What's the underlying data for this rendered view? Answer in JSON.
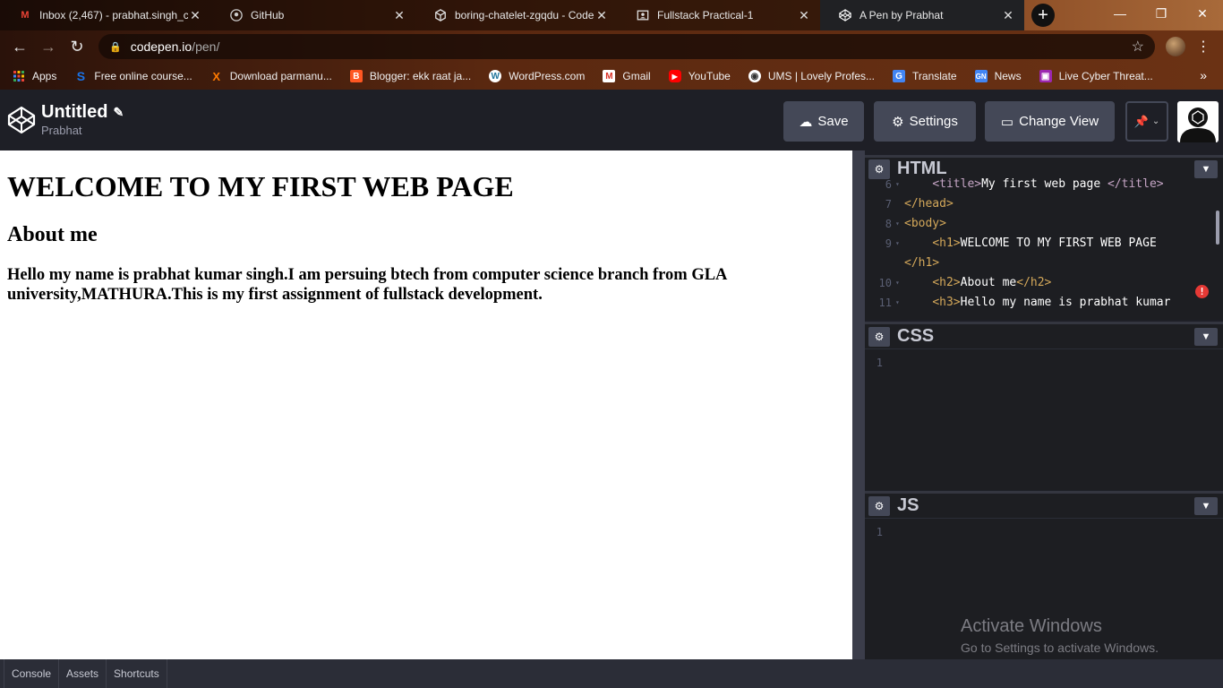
{
  "browser": {
    "tabs": [
      {
        "title": "Inbox (2,467) - prabhat.singh_c",
        "icon": "gmail-icon",
        "close": "✕"
      },
      {
        "title": "GitHub",
        "icon": "github-icon",
        "close": "✕"
      },
      {
        "title": "boring-chatelet-zgqdu - CodeS",
        "icon": "codesandbox-icon",
        "close": "✕"
      },
      {
        "title": "Fullstack Practical-1",
        "icon": "classroom-icon",
        "close": "✕"
      },
      {
        "title": "A Pen by Prabhat",
        "icon": "codepen-icon",
        "close": "✕"
      }
    ],
    "url_host": "codepen.io",
    "url_path": "/pen/",
    "bookmarks": [
      {
        "label": "Apps",
        "icon": "apps-grid-icon",
        "color": "#e94235"
      },
      {
        "label": "Free online course...",
        "icon": "course-icon",
        "color": "#1a73e8"
      },
      {
        "label": "Download parmanu...",
        "icon": "x-icon",
        "color": "#ff7a00"
      },
      {
        "label": "Blogger: ekk raat ja...",
        "icon": "blogger-icon",
        "color": "#ff5722"
      },
      {
        "label": "WordPress.com",
        "icon": "wordpress-icon",
        "color": "#21759b"
      },
      {
        "label": "Gmail",
        "icon": "gmail-icon",
        "color": "#d93025"
      },
      {
        "label": "YouTube",
        "icon": "youtube-icon",
        "color": "#ff0000"
      },
      {
        "label": "UMS | Lovely Profes...",
        "icon": "globe-icon",
        "color": "#ffffff"
      },
      {
        "label": "Translate",
        "icon": "translate-icon",
        "color": "#4285f4"
      },
      {
        "label": "News",
        "icon": "news-icon",
        "color": "#4285f4"
      },
      {
        "label": "Live Cyber Threat...",
        "icon": "threat-map-icon",
        "color": "#9c27b0"
      }
    ],
    "bookmarks_more": "»"
  },
  "codepen": {
    "title": "Untitled",
    "owner": "Prabhat",
    "buttons": {
      "save": "Save",
      "settings": "Settings",
      "change_view": "Change View"
    }
  },
  "preview": {
    "h1": "WELCOME TO MY FIRST WEB PAGE",
    "h2": "About me",
    "h3": "Hello my name is prabhat kumar singh.I am persuing btech from computer science branch from GLA university,MATHURA.This is my first assignment of fullstack development."
  },
  "editors": {
    "html": {
      "title": "HTML",
      "lines": [
        {
          "n": "6",
          "indent": "    ",
          "open": "<title>",
          "text": "My first web page ",
          "close": "</title>"
        },
        {
          "n": "7",
          "indent": "",
          "open": "</head>",
          "text": "",
          "close": ""
        },
        {
          "n": "8",
          "indent": "",
          "open": "<body>",
          "text": "",
          "close": ""
        },
        {
          "n": "9",
          "indent": "    ",
          "open": "<h1>",
          "text": "WELCOME TO MY FIRST WEB PAGE",
          "close": ""
        },
        {
          "n": "",
          "indent": "",
          "open": "</h1>",
          "text": "",
          "close": ""
        },
        {
          "n": "10",
          "indent": "    ",
          "open": "<h2>",
          "text": "About me",
          "close": "</h2>"
        },
        {
          "n": "11",
          "indent": "    ",
          "open": "<h3>",
          "text": "Hello my name is prabhat kumar",
          "close": ""
        }
      ],
      "error_marker": "!"
    },
    "css": {
      "title": "CSS",
      "line_number": "1"
    },
    "js": {
      "title": "JS",
      "line_number": "1"
    }
  },
  "watermark": {
    "line1": "Activate Windows",
    "line2": "Go to Settings to activate Windows."
  },
  "footer": {
    "console": "Console",
    "assets": "Assets",
    "shortcuts": "Shortcuts"
  }
}
